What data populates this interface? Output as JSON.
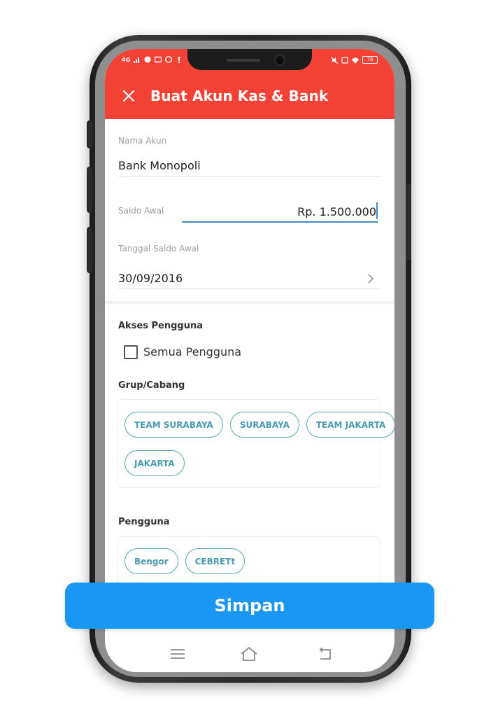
{
  "status_bar": {
    "left": "4G",
    "battery": "76"
  },
  "app_bar": {
    "title": "Buat Akun Kas & Bank"
  },
  "form": {
    "nama_akun_label": "Nama Akun",
    "nama_akun_value": "Bank Monopoli",
    "saldo_awal_label": "Saldo Awal",
    "saldo_awal_value": "Rp. 1.500.000",
    "tanggal_label": "Tanggal Saldo Awal",
    "tanggal_value": "30/09/2016"
  },
  "akses": {
    "title": "Akses Pengguna",
    "semua_label": "Semua Pengguna",
    "semua_checked": false
  },
  "grup": {
    "title": "Grup/Cabang",
    "chips": [
      "TEAM SURABAYA",
      "SURABAYA",
      "TEAM JAKARTA",
      "JAKARTA"
    ]
  },
  "pengguna": {
    "title": "Pengguna",
    "chips": [
      "Bengor",
      "CEBRETt"
    ]
  },
  "save_button": {
    "label": "Simpan"
  },
  "colors": {
    "app_bar": "#f44336",
    "primary": "#1a96f3",
    "chip": "#4a9bb0"
  },
  "icons": {
    "close": "close-icon",
    "chevron": "chevron-right-icon",
    "nav_menu": "menu-icon",
    "nav_home": "home-icon",
    "nav_back": "back-icon"
  }
}
